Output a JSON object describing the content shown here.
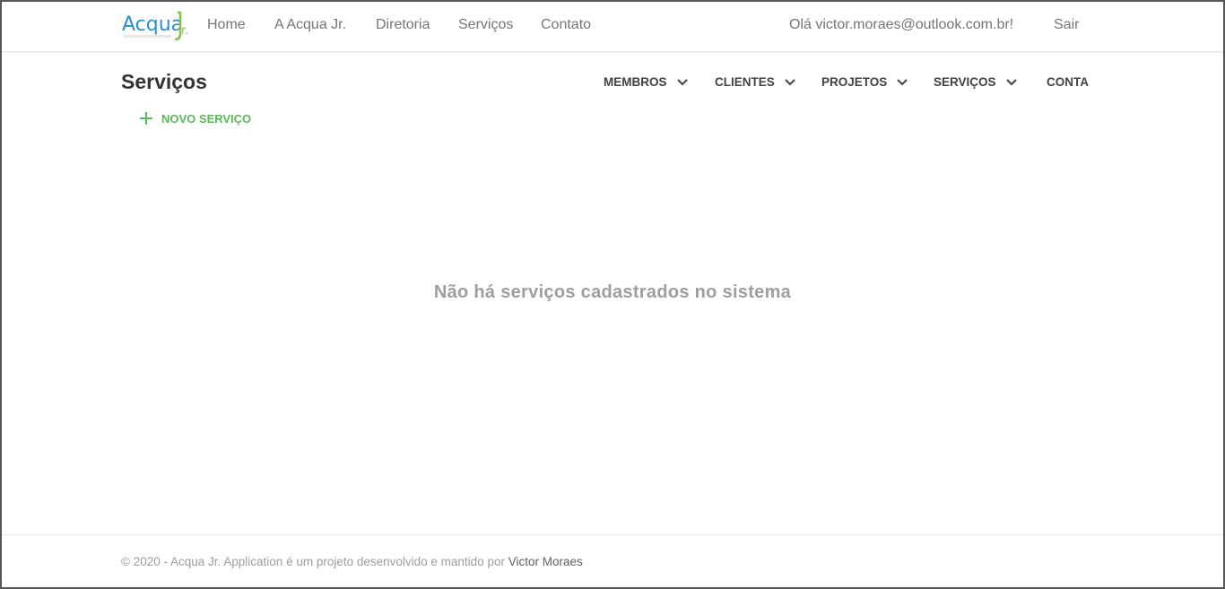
{
  "header": {
    "logo_text": "AcquaJr.",
    "nav": [
      "Home",
      "A Acqua Jr.",
      "Diretoria",
      "Serviços",
      "Contato"
    ],
    "greeting": "Olá victor.moraes@outlook.com.br!",
    "logout": "Sair"
  },
  "page": {
    "title": "Serviços",
    "subnav": {
      "members": "MEMBROS",
      "clients": "CLIENTES",
      "projects": "PROJETOS",
      "services": "SERVIÇOS",
      "account": "CONTA"
    },
    "new_service": "NOVO SERVIÇO",
    "empty_message": "Não há serviços cadastrados no sistema"
  },
  "footer": {
    "text": "© 2020 - Acqua Jr. Application é um projeto desenvolvido e mantido por ",
    "author": "Victor Moraes"
  },
  "colors": {
    "accent_green": "#5cb85c",
    "logo_blue": "#2a8fc9",
    "logo_green": "#8bc34a"
  },
  "icons": {
    "chevron": "chevron-down-icon",
    "plus": "plus-icon"
  }
}
